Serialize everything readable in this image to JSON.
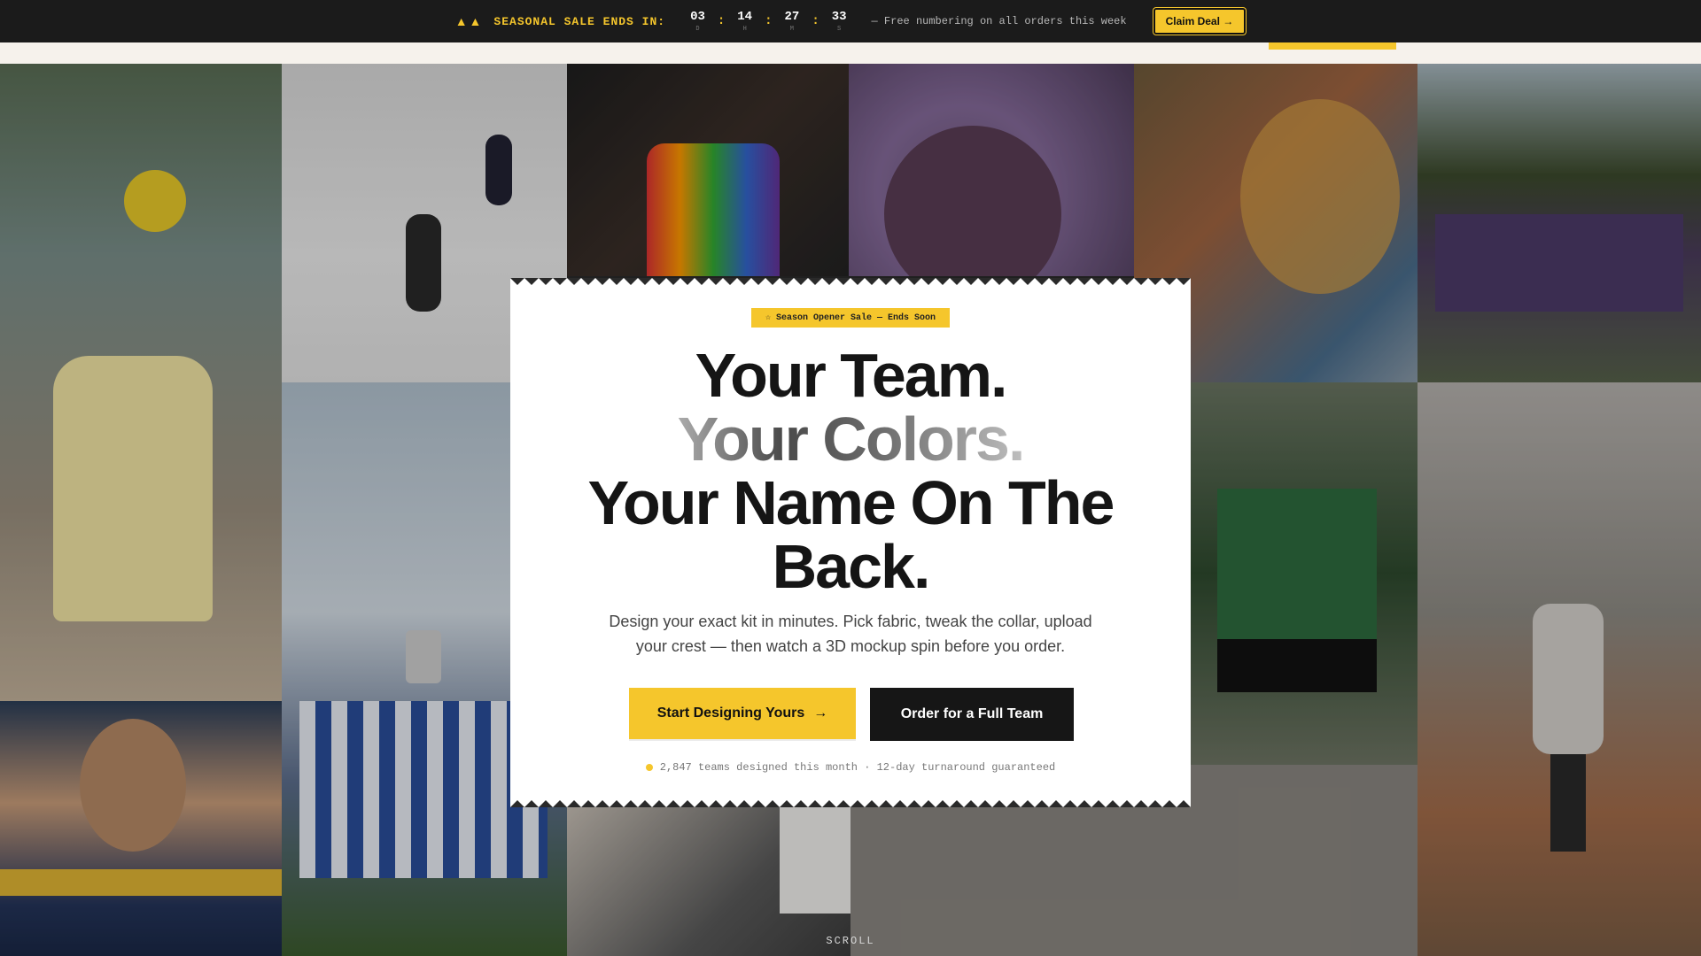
{
  "promo": {
    "icons": "▲▲",
    "title": "SEASONAL SALE ENDS IN:",
    "countdown": [
      {
        "value": "03",
        "unit": "D"
      },
      {
        "value": "14",
        "unit": "H"
      },
      {
        "value": "27",
        "unit": "M"
      },
      {
        "value": "33",
        "unit": "S"
      }
    ],
    "separator": ":",
    "note": "— Free numbering on all orders this week",
    "claim_label": "Claim Deal →"
  },
  "hero": {
    "badge": "☆ Season Opener Sale — Ends Soon",
    "headline_line1": "Your Team.",
    "headline_line2": "Your Colors.",
    "headline_line3": "Your Name On The",
    "headline_line4": "Back.",
    "subtitle": "Design your exact kit in minutes. Pick fabric, tweak the collar, upload your crest — then watch a 3D mockup spin before you order.",
    "primary_cta": "Start Designing Yours",
    "primary_cta_arrow": "→",
    "secondary_cta": "Order for a Full Team",
    "social_proof": "2,847 teams designed this month · 12-day turnaround guaranteed"
  },
  "scroll_hint": "SCROLL",
  "colors": {
    "accent": "#f5c62c",
    "dark": "#1b1b1b",
    "card": "#ffffff"
  }
}
